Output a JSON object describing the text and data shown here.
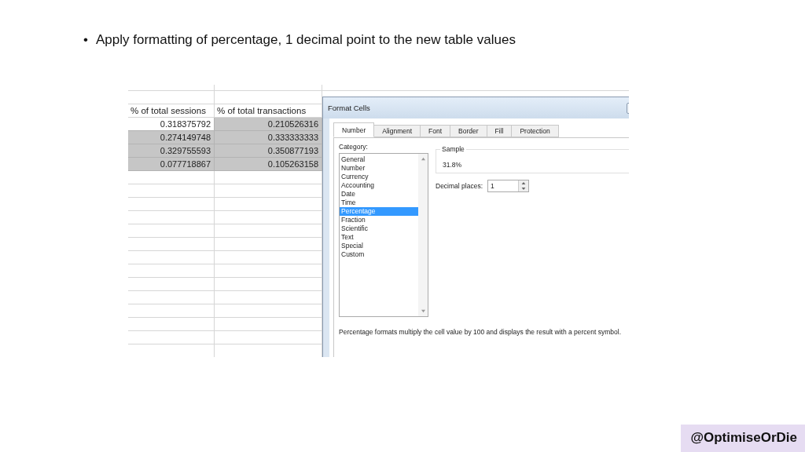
{
  "slide": {
    "bullet": "•",
    "text": "Apply formatting of percentage, 1 decimal point to the new table values",
    "handle": "@OptimiseOrDie"
  },
  "sheet": {
    "columns": [
      "% of total sessions",
      "% of total transactions"
    ],
    "rows": [
      {
        "selected": true,
        "cells": [
          {
            "text": "0.318375792",
            "active": true
          },
          {
            "text": "0.210526316",
            "active": false
          }
        ]
      },
      {
        "selected": true,
        "cells": [
          {
            "text": "0.274149748",
            "active": false
          },
          {
            "text": "0.333333333",
            "active": false
          }
        ]
      },
      {
        "selected": true,
        "cells": [
          {
            "text": "0.329755593",
            "active": false
          },
          {
            "text": "0.350877193",
            "active": false
          }
        ]
      },
      {
        "selected": true,
        "cells": [
          {
            "text": "0.077718867",
            "active": false
          },
          {
            "text": "0.105263158",
            "active": false
          }
        ]
      }
    ]
  },
  "dialog": {
    "title": "Format Cells",
    "tabs": [
      {
        "label": "Number",
        "selected": true
      },
      {
        "label": "Alignment",
        "selected": false
      },
      {
        "label": "Font",
        "selected": false
      },
      {
        "label": "Border",
        "selected": false
      },
      {
        "label": "Fill",
        "selected": false
      },
      {
        "label": "Protection",
        "selected": false
      }
    ],
    "category_label": "Category:",
    "categories": [
      {
        "label": "General",
        "selected": false
      },
      {
        "label": "Number",
        "selected": false
      },
      {
        "label": "Currency",
        "selected": false
      },
      {
        "label": "Accounting",
        "selected": false
      },
      {
        "label": "Date",
        "selected": false
      },
      {
        "label": "Time",
        "selected": false
      },
      {
        "label": "Percentage",
        "selected": true
      },
      {
        "label": "Fraction",
        "selected": false
      },
      {
        "label": "Scientific",
        "selected": false
      },
      {
        "label": "Text",
        "selected": false
      },
      {
        "label": "Special",
        "selected": false
      },
      {
        "label": "Custom",
        "selected": false
      }
    ],
    "sample_label": "Sample",
    "sample_value": "31.8%",
    "decimal_label": "Decimal places:",
    "decimal_value": "1",
    "description": "Percentage formats multiply the cell value by 100 and displays the result with a percent symbol."
  }
}
